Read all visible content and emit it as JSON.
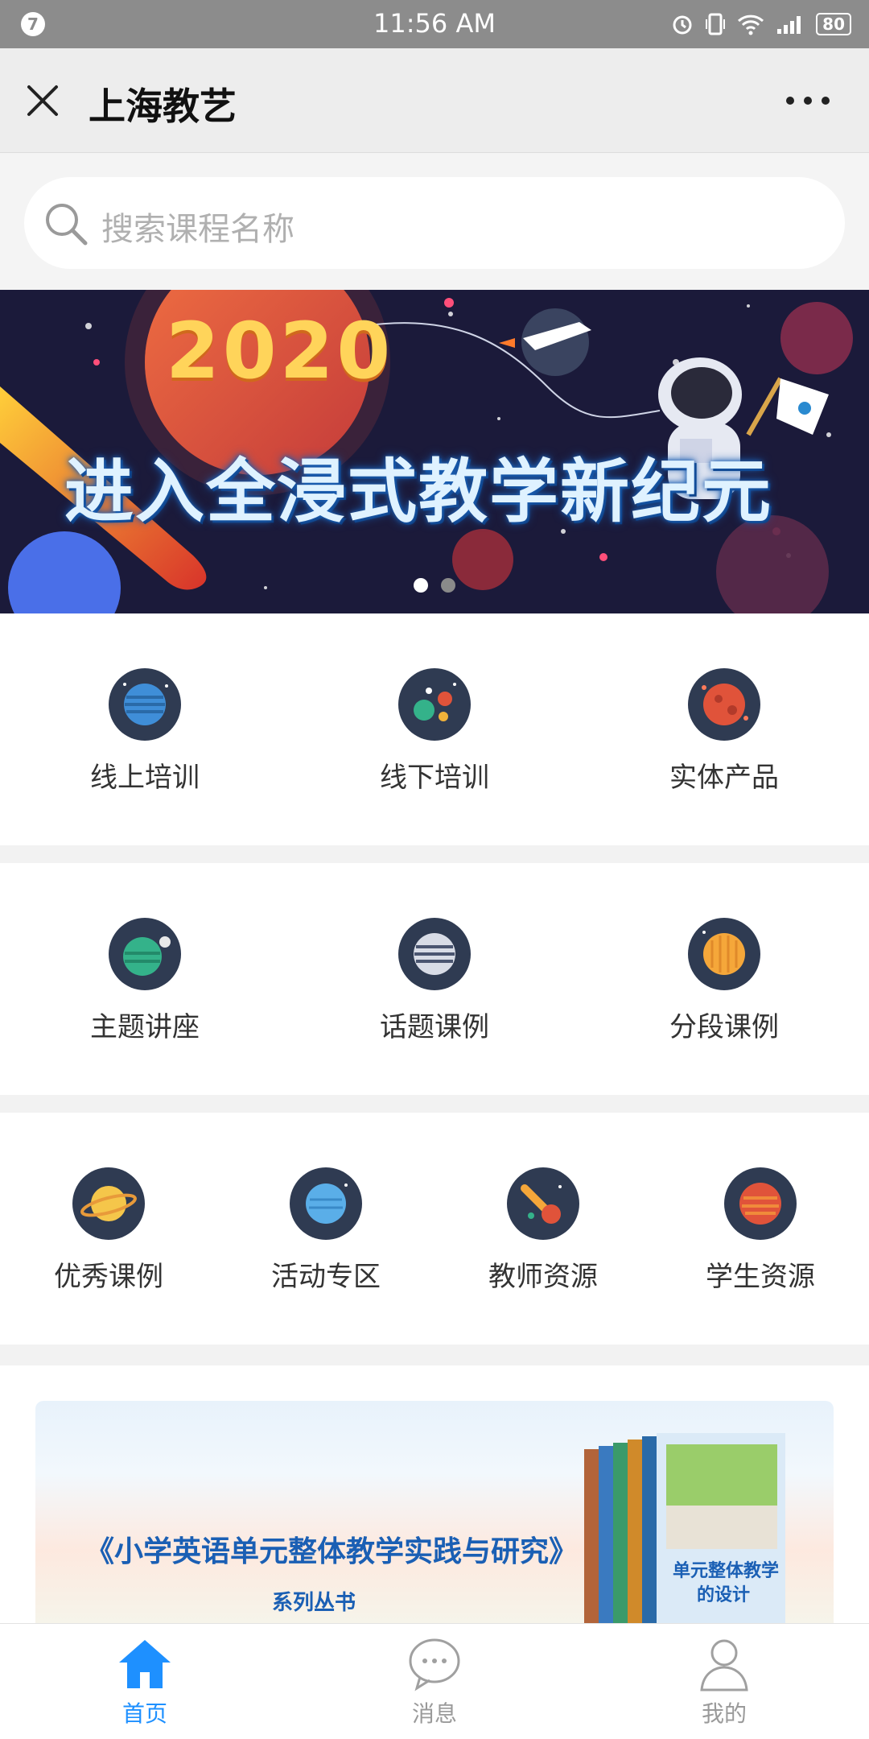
{
  "status_bar": {
    "notification_badge": "7",
    "time": "11:56 AM",
    "battery": "80"
  },
  "titlebar": {
    "title": "上海教艺"
  },
  "search": {
    "placeholder": "搜索课程名称"
  },
  "banner": {
    "year": "2020",
    "headline": "进入全浸式教学新纪元",
    "slides_count": 2,
    "active_slide": 1
  },
  "sections": [
    {
      "items": [
        {
          "label": "线上培训",
          "icon": "planet-striped-blue-icon"
        },
        {
          "label": "线下培训",
          "icon": "planet-cluster-icon"
        },
        {
          "label": "实体产品",
          "icon": "planet-red-icon"
        }
      ]
    },
    {
      "items": [
        {
          "label": "主题讲座",
          "icon": "planet-green-moon-icon"
        },
        {
          "label": "话题课例",
          "icon": "planet-grey-striped-icon"
        },
        {
          "label": "分段课例",
          "icon": "planet-orange-icon"
        }
      ]
    },
    {
      "items": [
        {
          "label": "优秀课例",
          "icon": "planet-ringed-yellow-icon"
        },
        {
          "label": "活动专区",
          "icon": "planet-light-blue-icon"
        },
        {
          "label": "教师资源",
          "icon": "comet-icon"
        },
        {
          "label": "学生资源",
          "icon": "planet-red-striped-icon"
        }
      ]
    }
  ],
  "promo": {
    "title": "《小学英语单元整体教学实践与研究》",
    "subtitle": "系列丛书",
    "book_cover_text": "单元整体教学的设计"
  },
  "tabbar": {
    "items": [
      {
        "label": "首页",
        "icon": "home-icon",
        "active": true
      },
      {
        "label": "消息",
        "icon": "message-icon",
        "active": false
      },
      {
        "label": "我的",
        "icon": "profile-icon",
        "active": false
      }
    ]
  },
  "colors": {
    "accent": "#1e90ff",
    "icon_bg": "#2f3b52",
    "titlebar_bg": "#ededed",
    "statusbar_bg": "#8c8c8c"
  }
}
